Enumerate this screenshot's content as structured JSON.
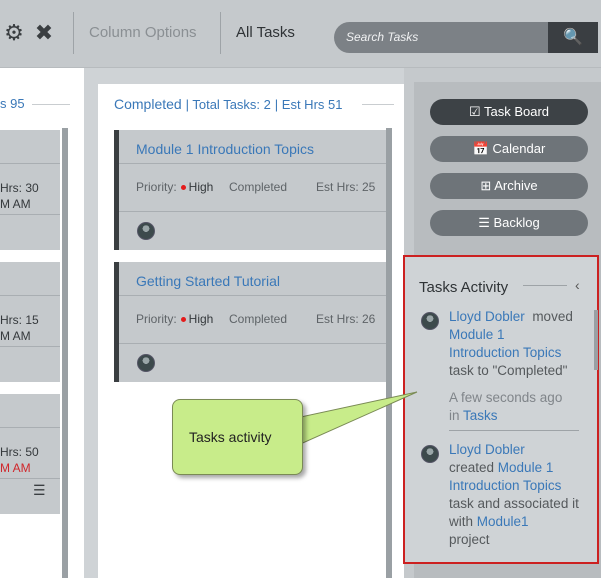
{
  "toolbar": {
    "column_options": "Column Options",
    "all_tasks": "All Tasks",
    "search_placeholder": "Search Tasks"
  },
  "left_column": {
    "header_fragment": "s 95",
    "cards": [
      {
        "est": "Hrs: 30",
        "time": "M AM"
      },
      {
        "est": "Hrs: 15",
        "time": "M AM"
      },
      {
        "est": "Hrs: 50",
        "time": "M AM"
      }
    ]
  },
  "middle_column": {
    "title": "Completed",
    "total_tasks": "Total Tasks: 2",
    "est_hrs": "Est Hrs 51",
    "cards": [
      {
        "title": "Module 1 Introduction Topics",
        "priority_label": "Priority:",
        "priority": "High",
        "status": "Completed",
        "est": "Est Hrs: 25"
      },
      {
        "title": "Getting Started Tutorial",
        "priority_label": "Priority:",
        "priority": "High",
        "status": "Completed",
        "est": "Est Hrs: 26"
      }
    ]
  },
  "right_panel": {
    "buttons": [
      "Task Board",
      "Calendar",
      "Archive",
      "Backlog"
    ],
    "activity_title": "Tasks Activity",
    "activity": [
      {
        "user": "Lloyd Dobler",
        "verb": "moved",
        "task": "Module 1 Introduction Topics",
        "tail": "task to \"Completed\"",
        "time": "A few seconds ago",
        "in": "in",
        "where": "Tasks"
      },
      {
        "user": "Lloyd Dobler",
        "verb": "created",
        "task": "Module 1 Introduction Topics",
        "tail": "task and associated it with",
        "project": "Module1",
        "tail2": "project"
      }
    ]
  },
  "callout": {
    "text": "Tasks activity"
  },
  "colors": {
    "accent": "#3a78b8",
    "highlight_border": "#cc2020",
    "callout_fill": "#c8ec8a",
    "priority_dot": "#e41b1b"
  }
}
